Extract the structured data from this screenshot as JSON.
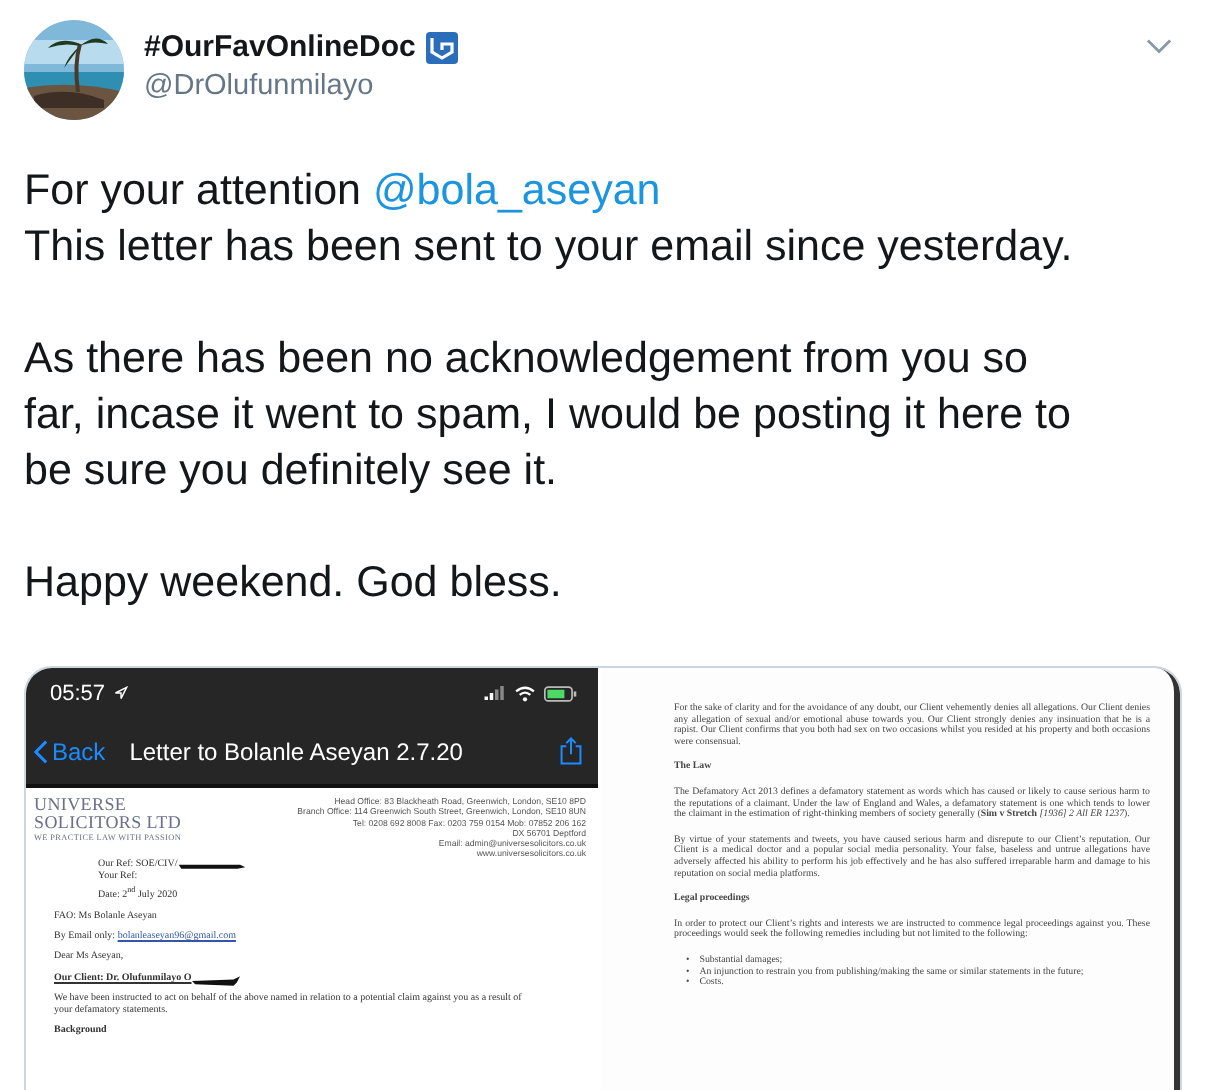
{
  "tweet": {
    "display_name": "#OurFavOnlineDoc",
    "handle": "@DrOlufunmilayo",
    "paragraphs": [
      {
        "lines": [
          [
            {
              "kind": "text",
              "text": "For your attention "
            },
            {
              "kind": "mention",
              "text": "@bola_aseyan"
            }
          ],
          [
            {
              "kind": "text",
              "text": "This letter has been sent to your email since yesterday."
            }
          ]
        ]
      },
      {
        "lines": [
          [
            {
              "kind": "text",
              "text": "As there has been no acknowledgement from you so"
            }
          ],
          [
            {
              "kind": "text",
              "text": "far, incase it went to spam, I would be posting it here to"
            }
          ],
          [
            {
              "kind": "text",
              "text": "be sure you definitely see it."
            }
          ]
        ]
      },
      {
        "lines": [
          [
            {
              "kind": "text",
              "text": "Happy weekend. God bless."
            }
          ]
        ]
      }
    ]
  },
  "images": [
    {
      "kind": "phone",
      "time": "05:57",
      "back": "Back",
      "title": "Letter to Bolanle Aseyan 2.7.20",
      "logo": [
        "UNIVERSE",
        "SOLICITORS LTD"
      ],
      "tagline": "WE PRACTICE LAW WITH PASSION",
      "address": [
        "Head Office: 83 Blackheath Road, Greenwich, London, SE10 8PD",
        "Branch Office: 114 Greenwich South Street, Greenwich, London, SE10 8UN",
        "Tel: 0208 692 8008   Fax: 0203 759 0154   Mob: 07852 206 162",
        "DX 56701 Deptford",
        "Email: admin@universesolicitors.co.uk",
        "www.universesolicitors.co.uk"
      ],
      "refs": [
        {
          "text": "Our Ref: SOE/CIV/",
          "redacted": true
        },
        {
          "text": "Your Ref:",
          "redacted": false
        },
        {
          "text": "Date: 2$^{nd}$ July 2020",
          "redacted": false
        }
      ],
      "blocks": [
        {
          "kind": "para",
          "text": "FAO: Ms Bolanle Aseyan"
        },
        {
          "kind": "email",
          "label": "By Email only: ",
          "link": "bolanleaseyan96@gmail.com"
        },
        {
          "kind": "para",
          "text": "Dear Ms Aseyan,"
        },
        {
          "kind": "client",
          "text": "Our Client: Dr. Olufunmilayo O",
          "redacted": true
        },
        {
          "kind": "para",
          "text": "We have been instructed to act on behalf of the above named in relation to a potential claim against you as a result of your defamatory statements."
        },
        {
          "kind": "heading",
          "text": "Background"
        }
      ]
    },
    {
      "kind": "page",
      "blocks": [
        {
          "kind": "para",
          "text": "For the sake of clarity and for the avoidance of any doubt, our Client vehemently denies all allegations. Our Client denies any allegation of sexual and/or emotional abuse towards you. Our Client strongly denies any insinuation that he is a rapist. Our Client confirms that you both had sex on two occasions whilst you resided at his property and both occasions were consensual."
        },
        {
          "kind": "heading",
          "text": "The Law"
        },
        {
          "kind": "para",
          "text": "The Defamatory Act 2013 defines a defamatory statement as words which has caused or likely to cause serious harm to the reputations of a claimant. Under the law of England and Wales, a defamatory statement is one which tends to lower the claimant in the estimation of right-thinking members of society generally (**Sim v Stretch** *[1936] 2 All ER 1237*)."
        },
        {
          "kind": "para",
          "text": "By virtue of your statements and tweets, you have caused serious harm and disrepute to our Client’s reputation. Our Client is a medical doctor and a popular social media personality. Your false, baseless and untrue allegations have adversely affected his ability to perform his job effectively and he has also suffered irreparable harm and damage to his reputation on social media platforms."
        },
        {
          "kind": "heading",
          "text": "Legal proceedings"
        },
        {
          "kind": "para",
          "text": "In order to protect our Client’s rights and interests we are instructed to commence legal proceedings against you. These proceedings would seek the following remedies including but not limited to the following:"
        },
        {
          "kind": "bullets",
          "marker": "•",
          "items": [
            "Substantial damages;",
            "An injunction to restrain you from publishing/making the same or similar statements in the future;",
            "Costs."
          ]
        }
      ]
    }
  ]
}
